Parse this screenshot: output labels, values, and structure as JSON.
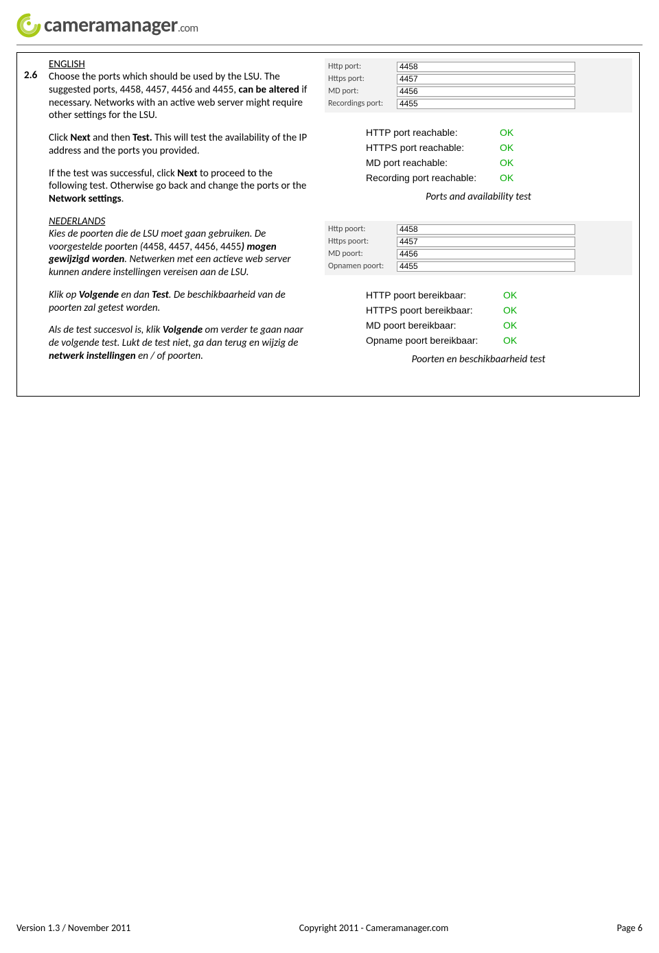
{
  "logo": {
    "name": "cameramanager",
    "suffix": ".com"
  },
  "step": "2.6",
  "english": {
    "heading": "ENGLISH",
    "p1a": "Choose the ports which should be used by the LSU. The suggested ports, 4458, 4457, 4456 and 4455, ",
    "p1b": "can be altered",
    "p1c": " if necessary. Networks with an active web server might require other settings for the LSU.",
    "p2a": "Click ",
    "p2b": "Next",
    "p2c": " and then ",
    "p2d": "Test.",
    "p2e": " This will test the availability of the IP address and the ports you provided.",
    "p3a": "If the test was successful, click ",
    "p3b": "Next",
    "p3c": " to proceed to the following test. Otherwise go back and change the ports or the ",
    "p3d": "Network settings",
    "p3e": "."
  },
  "dutch": {
    "heading": "NEDERLANDS",
    "p1a": "Kies de poorten die de LSU moet gaan gebruiken. De voorgestelde poorten (",
    "p1b": "4458, 4457, 4456, 4455",
    "p1c": ") mogen gewijzigd worden",
    "p1d": ". Netwerken met een actieve web server kunnen andere instellingen vereisen aan de LSU.",
    "p2a": "Klik op ",
    "p2b": "Volgende",
    "p2c": " en dan ",
    "p2d": "Test",
    "p2e": ". De beschikbaarheid van de poorten zal getest worden.",
    "p3a": "Als de test succesvol is, klik ",
    "p3b": "Volgende",
    "p3c": " om verder te gaan naar de volgende test. Lukt de test niet, ga dan terug en wijzig de ",
    "p3d": "netwerk instellingen",
    "p3e": " en / of poorten."
  },
  "ports_en": {
    "rows": [
      {
        "label": "Http port:",
        "value": "4458"
      },
      {
        "label": "Https port:",
        "value": "4457"
      },
      {
        "label": "MD port:",
        "value": "4456"
      },
      {
        "label": "Recordings port:",
        "value": "4455"
      }
    ]
  },
  "status_en": {
    "rows": [
      {
        "label": "HTTP port reachable:",
        "status": "OK"
      },
      {
        "label": "HTTPS port reachable:",
        "status": "OK"
      },
      {
        "label": "MD port reachable:",
        "status": "OK"
      },
      {
        "label": "Recording port reachable:",
        "status": "OK"
      }
    ]
  },
  "caption_en": "Ports and availability test",
  "ports_nl": {
    "rows": [
      {
        "label": "Http poort:",
        "value": "4458"
      },
      {
        "label": "Https poort:",
        "value": "4457"
      },
      {
        "label": "MD poort:",
        "value": "4456"
      },
      {
        "label": "Opnamen poort:",
        "value": "4455"
      }
    ]
  },
  "status_nl": {
    "rows": [
      {
        "label": "HTTP poort bereikbaar:",
        "status": "OK"
      },
      {
        "label": "HTTPS poort bereikbaar:",
        "status": "OK"
      },
      {
        "label": "MD poort bereikbaar:",
        "status": "OK"
      },
      {
        "label": "Opname poort bereikbaar:",
        "status": "OK"
      }
    ]
  },
  "caption_nl": "Poorten en beschikbaarheid test",
  "footer": {
    "left": "Version 1.3 / November 2011",
    "center": "Copyright 2011 - Cameramanager.com",
    "right": "Page 6"
  }
}
